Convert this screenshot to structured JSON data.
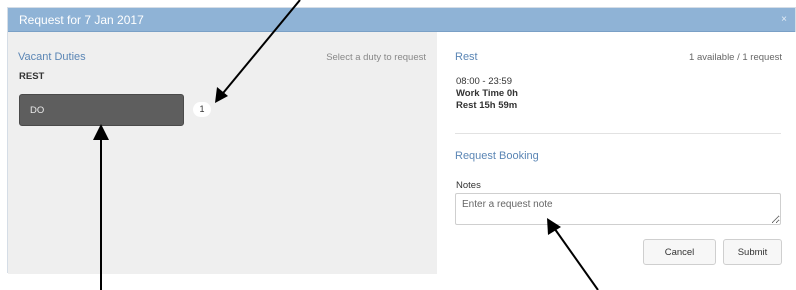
{
  "modal": {
    "title": "Request for 7 Jan 2017",
    "close_glyph": "×"
  },
  "vacant": {
    "title": "Vacant Duties",
    "hint": "Select a duty to request",
    "section_label": "REST",
    "duties": [
      {
        "label": "DO",
        "count": "1"
      }
    ]
  },
  "detail": {
    "title": "Rest",
    "availability": "1 available / 1 request",
    "time_range": "08:00 - 23:59",
    "work_time": "Work Time 0h",
    "rest_time": "Rest 15h 59m"
  },
  "booking": {
    "title": "Request Booking",
    "notes_label": "Notes",
    "notes_placeholder": "Enter a request note",
    "notes_value": "",
    "cancel_label": "Cancel",
    "submit_label": "Submit"
  },
  "colors": {
    "header_bg": "#8fb3d6",
    "accent": "#5b86b5",
    "duty_button_bg": "#5e5e5e",
    "left_pane_bg": "#efefef",
    "annotation_arrow": "#000000"
  }
}
